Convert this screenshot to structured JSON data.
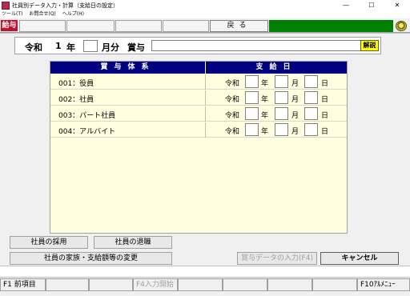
{
  "window": {
    "title": "社員別データ入力・計算（支給日の設定）",
    "minimize": "—",
    "maximize": "☐",
    "close": "✕"
  },
  "menu": [
    "ツール(T)",
    "お問合せ(Q)",
    "ヘルプ(H)"
  ],
  "toolbar": {
    "badge": "給与",
    "back_label": "戻る",
    "green_color": "#008000"
  },
  "header": {
    "era": "令和",
    "year": "1",
    "year_label": "年",
    "month_label": "月分",
    "bonus_label": "賞与",
    "month_value": "",
    "bonus_name_value": "",
    "help_label": "解説"
  },
  "table": {
    "col1_header": "賞与体系",
    "col2_header": "支給日",
    "rows": [
      {
        "label": "001：役員",
        "era": "令和",
        "year_unit": "年",
        "month_unit": "月",
        "day_unit": "日"
      },
      {
        "label": "002：社員",
        "era": "令和",
        "year_unit": "年",
        "month_unit": "月",
        "day_unit": "日"
      },
      {
        "label": "003：パート社員",
        "era": "令和",
        "year_unit": "年",
        "month_unit": "月",
        "day_unit": "日"
      },
      {
        "label": "004：アルバイト",
        "era": "令和",
        "year_unit": "年",
        "month_unit": "月",
        "day_unit": "日"
      }
    ]
  },
  "buttons": {
    "hire": "社員の採用",
    "retire": "社員の退職",
    "family": "社員の家族・支給額等の変更",
    "bonus_input": "賞与データの入力(F4)",
    "cancel": "キャンセル"
  },
  "fkeys": {
    "f1": "F1 前項目",
    "f4": "F4入力開始",
    "f10": "F10ｱﾙﾒﾆｭｰ"
  }
}
